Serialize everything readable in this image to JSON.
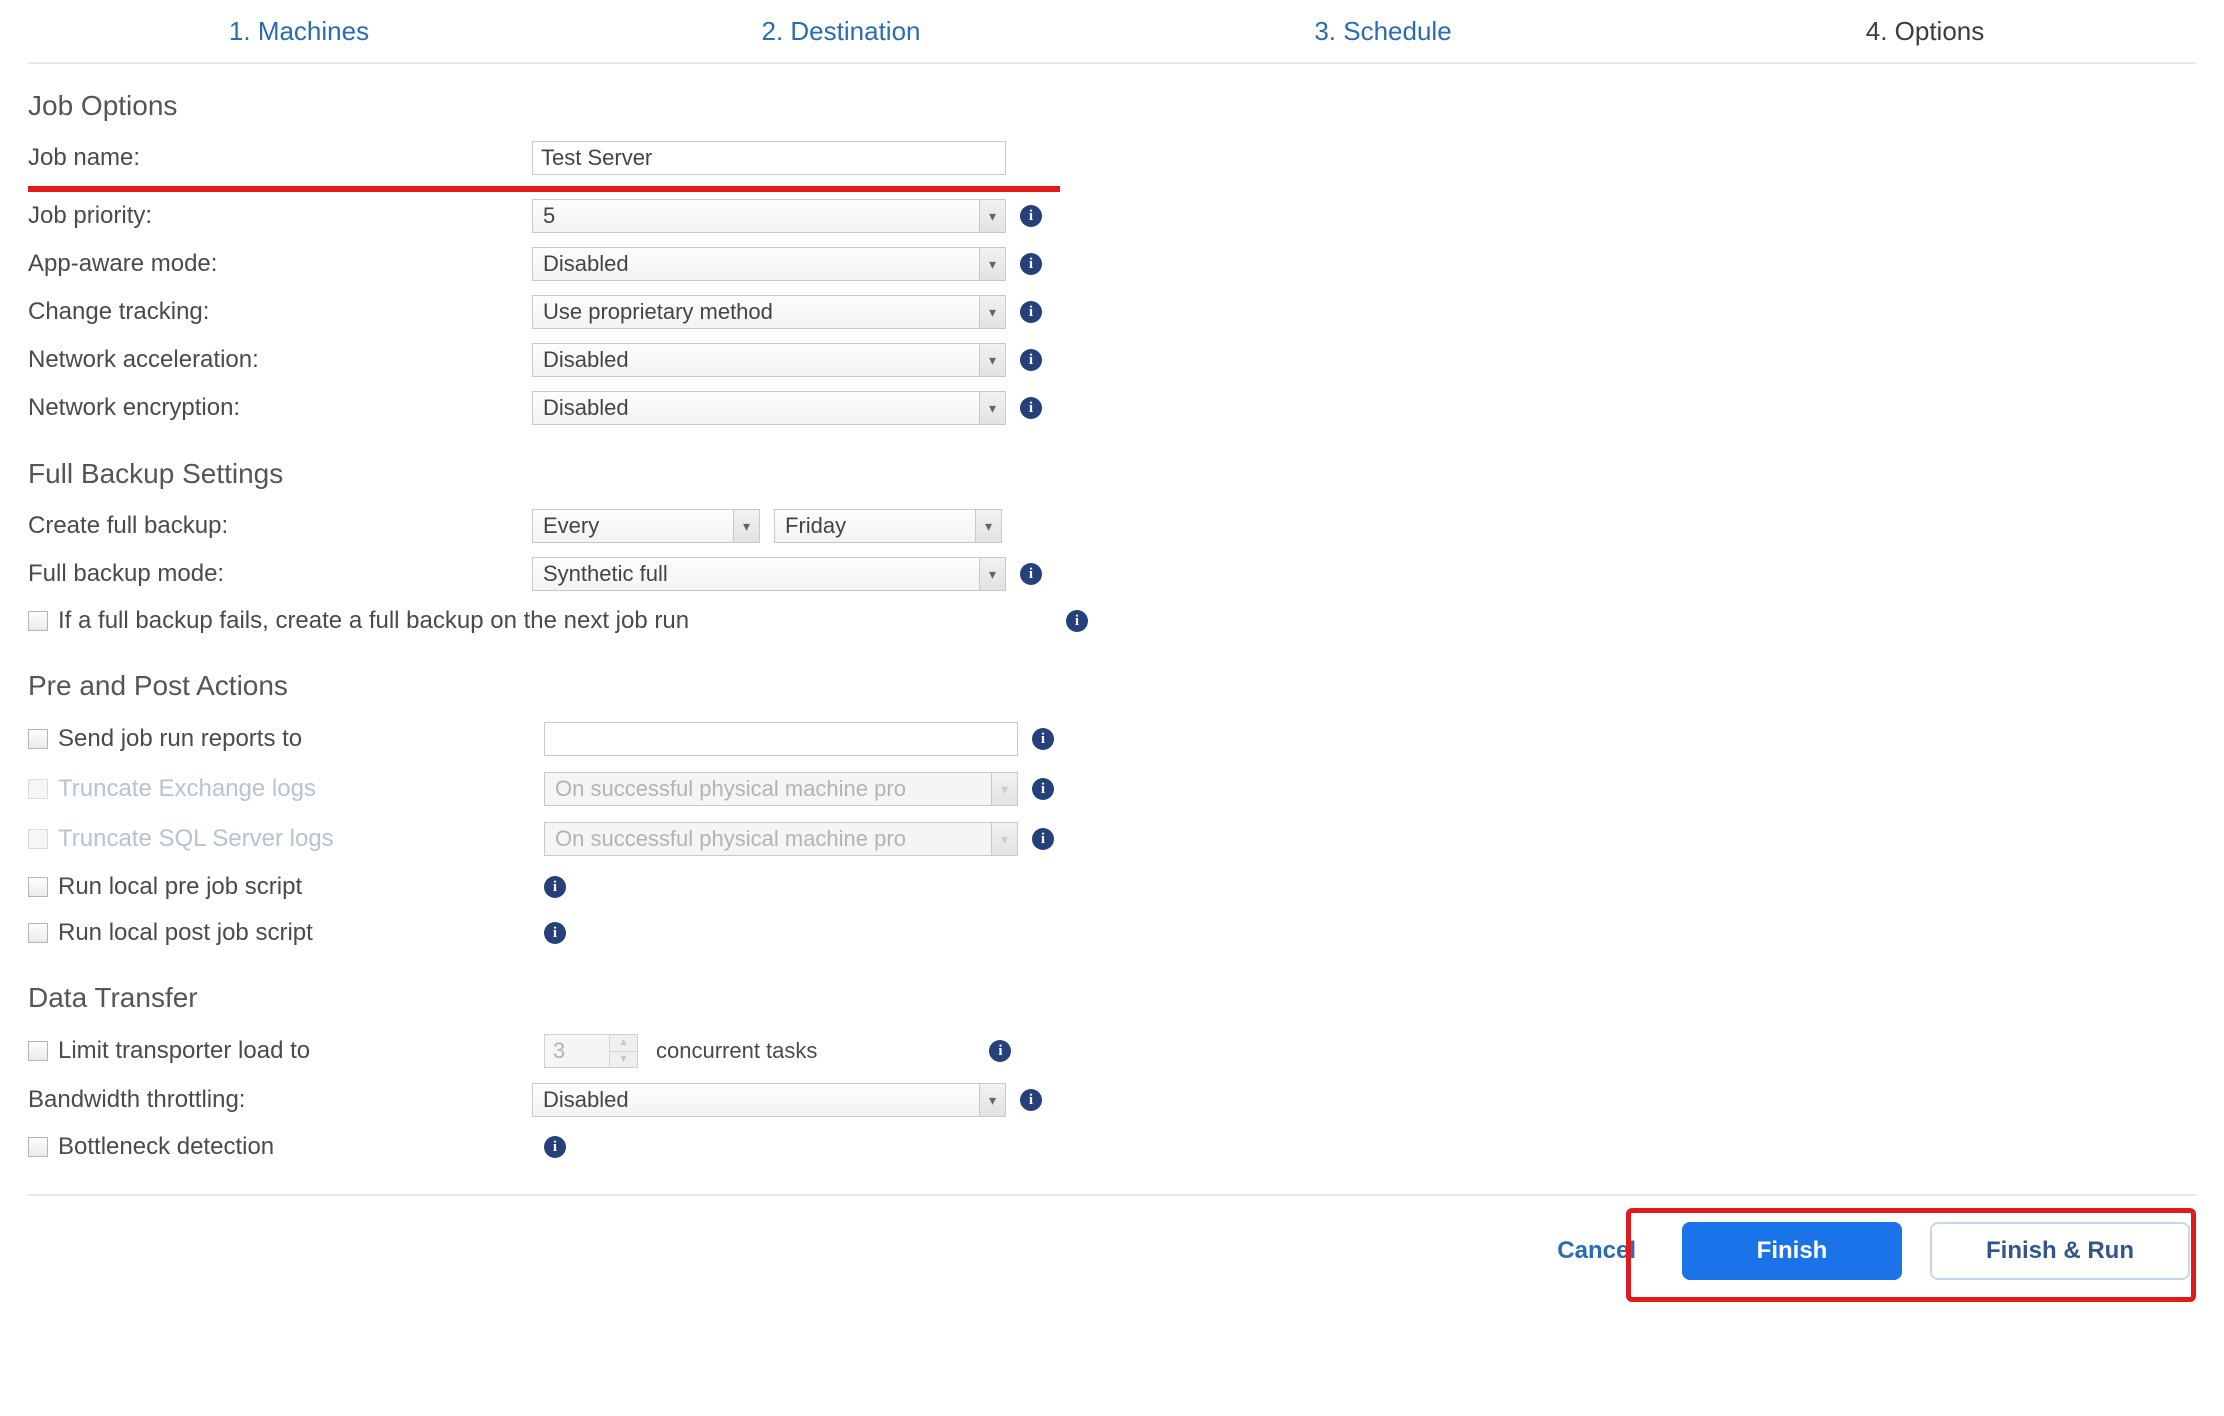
{
  "tabs": {
    "machines": "1. Machines",
    "destination": "2. Destination",
    "schedule": "3. Schedule",
    "options": "4. Options"
  },
  "sections": {
    "job_options": {
      "title": "Job Options",
      "job_name": {
        "label": "Job name:",
        "value": "Test Server"
      },
      "job_priority": {
        "label": "Job priority:",
        "value": "5"
      },
      "app_aware": {
        "label": "App-aware mode:",
        "value": "Disabled"
      },
      "change_tracking": {
        "label": "Change tracking:",
        "value": "Use proprietary method"
      },
      "net_accel": {
        "label": "Network acceleration:",
        "value": "Disabled"
      },
      "net_enc": {
        "label": "Network encryption:",
        "value": "Disabled"
      }
    },
    "full_backup": {
      "title": "Full Backup Settings",
      "create": {
        "label": "Create full backup:",
        "value1": "Every",
        "value2": "Friday"
      },
      "mode": {
        "label": "Full backup mode:",
        "value": "Synthetic full"
      },
      "retry": {
        "label": "If a full backup fails, create a full backup on the next job run"
      }
    },
    "pre_post": {
      "title": "Pre and Post Actions",
      "send_reports": {
        "label": "Send job run reports to",
        "value": ""
      },
      "trunc_exchange": {
        "label": "Truncate Exchange logs",
        "value": "On successful physical machine pro"
      },
      "trunc_sql": {
        "label": "Truncate SQL Server logs",
        "value": "On successful physical machine pro"
      },
      "pre_script": {
        "label": "Run local pre job script"
      },
      "post_script": {
        "label": "Run local post job script"
      }
    },
    "data_transfer": {
      "title": "Data Transfer",
      "limit": {
        "label": "Limit transporter load to",
        "value": "3",
        "suffix": "concurrent tasks"
      },
      "bandwidth": {
        "label": "Bandwidth throttling:",
        "value": "Disabled"
      },
      "bottleneck": {
        "label": "Bottleneck detection"
      }
    }
  },
  "footer": {
    "cancel": "Cancel",
    "finish": "Finish",
    "finish_run": "Finish & Run"
  },
  "glyphs": {
    "caret": "▾",
    "up": "▲",
    "down": "▼",
    "info": "i"
  }
}
